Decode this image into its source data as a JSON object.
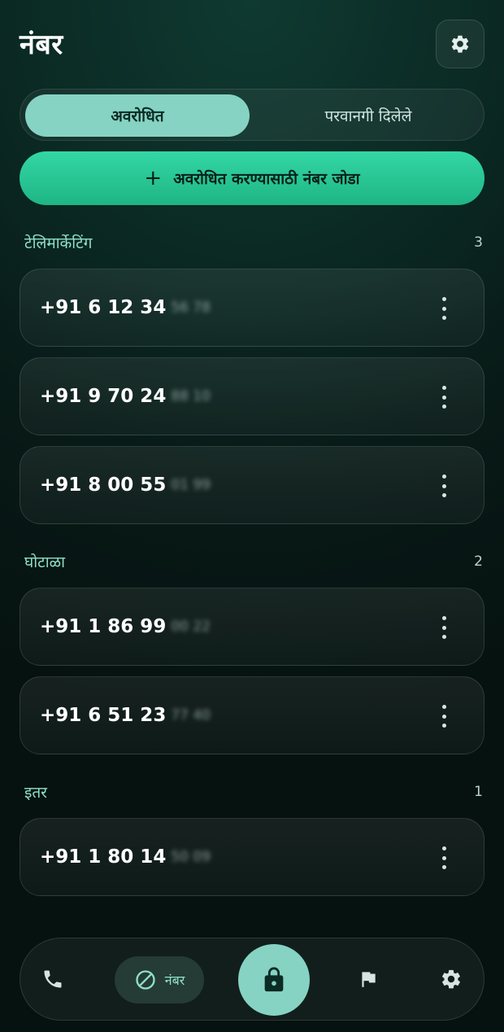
{
  "header": {
    "title": "नंबर",
    "settings_icon": "gear-icon"
  },
  "tabs": [
    {
      "label": "अवरोधित",
      "active": true
    },
    {
      "label": "परवानगी दिलेले",
      "active": false
    }
  ],
  "add_button": {
    "label": "अवरोधित करण्यासाठी नंबर जोडा",
    "icon": "plus-icon"
  },
  "sections": [
    {
      "title": "टेलिमार्केटिंग",
      "count": "3",
      "items": [
        {
          "number": "+91 6 12 34",
          "masked": "56 78"
        },
        {
          "number": "+91 9 70 24",
          "masked": "88 10"
        },
        {
          "number": "+91 8 00 55",
          "masked": "01 99"
        }
      ]
    },
    {
      "title": "घोटाळा",
      "count": "2",
      "items": [
        {
          "number": "+91 1 86 99",
          "masked": "00 22"
        },
        {
          "number": "+91 6 51 23",
          "masked": "77 40"
        }
      ]
    },
    {
      "title": "इतर",
      "count": "1",
      "items": [
        {
          "number": "+91 1 80 14",
          "masked": "50 09"
        }
      ]
    }
  ],
  "bottom_nav": {
    "items": [
      {
        "icon": "phone-icon"
      },
      {
        "icon": "block-icon",
        "label": "नंबर",
        "active": true
      },
      {
        "icon": "lock-icon",
        "primary": true
      },
      {
        "icon": "flag-icon"
      },
      {
        "icon": "gear-icon"
      }
    ]
  },
  "colors": {
    "accent": "#86d3c3",
    "button_green": "#2ccf9c",
    "section_title": "#8ee0c8",
    "background": "#0b2a24"
  }
}
